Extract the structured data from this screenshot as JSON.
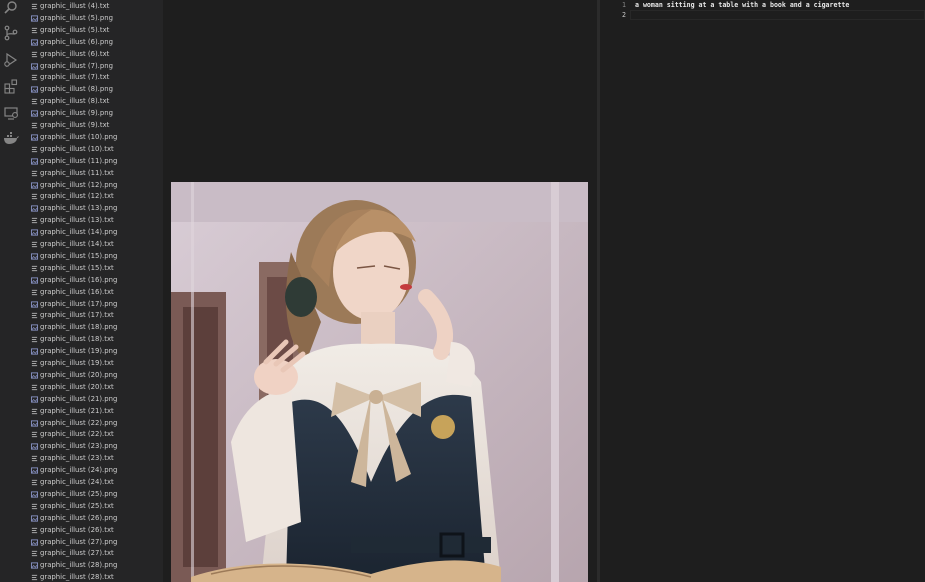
{
  "activity_bar": {
    "icons": [
      "search-icon",
      "source-control-icon",
      "run-debug-icon",
      "extensions-icon",
      "remote-explorer-icon",
      "docker-icon"
    ]
  },
  "explorer": {
    "files": [
      {
        "name": "graphic_illust (4).txt",
        "type": "txt"
      },
      {
        "name": "graphic_illust (5).png",
        "type": "png"
      },
      {
        "name": "graphic_illust (5).txt",
        "type": "txt"
      },
      {
        "name": "graphic_illust (6).png",
        "type": "png"
      },
      {
        "name": "graphic_illust (6).txt",
        "type": "txt"
      },
      {
        "name": "graphic_illust (7).png",
        "type": "png"
      },
      {
        "name": "graphic_illust (7).txt",
        "type": "txt"
      },
      {
        "name": "graphic_illust (8).png",
        "type": "png"
      },
      {
        "name": "graphic_illust (8).txt",
        "type": "txt"
      },
      {
        "name": "graphic_illust (9).png",
        "type": "png"
      },
      {
        "name": "graphic_illust (9).txt",
        "type": "txt"
      },
      {
        "name": "graphic_illust (10).png",
        "type": "png"
      },
      {
        "name": "graphic_illust (10).txt",
        "type": "txt"
      },
      {
        "name": "graphic_illust (11).png",
        "type": "png"
      },
      {
        "name": "graphic_illust (11).txt",
        "type": "txt"
      },
      {
        "name": "graphic_illust (12).png",
        "type": "png"
      },
      {
        "name": "graphic_illust (12).txt",
        "type": "txt"
      },
      {
        "name": "graphic_illust (13).png",
        "type": "png"
      },
      {
        "name": "graphic_illust (13).txt",
        "type": "txt"
      },
      {
        "name": "graphic_illust (14).png",
        "type": "png"
      },
      {
        "name": "graphic_illust (14).txt",
        "type": "txt"
      },
      {
        "name": "graphic_illust (15).png",
        "type": "png"
      },
      {
        "name": "graphic_illust (15).txt",
        "type": "txt"
      },
      {
        "name": "graphic_illust (16).png",
        "type": "png"
      },
      {
        "name": "graphic_illust (16).txt",
        "type": "txt"
      },
      {
        "name": "graphic_illust (17).png",
        "type": "png"
      },
      {
        "name": "graphic_illust (17).txt",
        "type": "txt"
      },
      {
        "name": "graphic_illust (18).png",
        "type": "png"
      },
      {
        "name": "graphic_illust (18).txt",
        "type": "txt"
      },
      {
        "name": "graphic_illust (19).png",
        "type": "png"
      },
      {
        "name": "graphic_illust (19).txt",
        "type": "txt"
      },
      {
        "name": "graphic_illust (20).png",
        "type": "png"
      },
      {
        "name": "graphic_illust (20).txt",
        "type": "txt"
      },
      {
        "name": "graphic_illust (21).png",
        "type": "png"
      },
      {
        "name": "graphic_illust (21).txt",
        "type": "txt"
      },
      {
        "name": "graphic_illust (22).png",
        "type": "png"
      },
      {
        "name": "graphic_illust (22).txt",
        "type": "txt"
      },
      {
        "name": "graphic_illust (23).png",
        "type": "png"
      },
      {
        "name": "graphic_illust (23).txt",
        "type": "txt"
      },
      {
        "name": "graphic_illust (24).png",
        "type": "png"
      },
      {
        "name": "graphic_illust (24).txt",
        "type": "txt"
      },
      {
        "name": "graphic_illust (25).png",
        "type": "png"
      },
      {
        "name": "graphic_illust (25).txt",
        "type": "txt"
      },
      {
        "name": "graphic_illust (26).png",
        "type": "png"
      },
      {
        "name": "graphic_illust (26).txt",
        "type": "txt"
      },
      {
        "name": "graphic_illust (27).png",
        "type": "png"
      },
      {
        "name": "graphic_illust (27).txt",
        "type": "txt"
      },
      {
        "name": "graphic_illust (28).png",
        "type": "png"
      },
      {
        "name": "graphic_illust (28).txt",
        "type": "txt"
      }
    ]
  },
  "editor": {
    "lines": [
      {
        "number": "1",
        "text": "a woman sitting at a table with a book and a cigarette"
      },
      {
        "number": "2",
        "text": ""
      }
    ]
  },
  "colors": {
    "background": "#1e1e1e",
    "sidebar": "#252526",
    "text": "#cccccc",
    "line_number": "#858585",
    "png_icon": "#8b95c8",
    "txt_icon": "#bbbbbb"
  }
}
